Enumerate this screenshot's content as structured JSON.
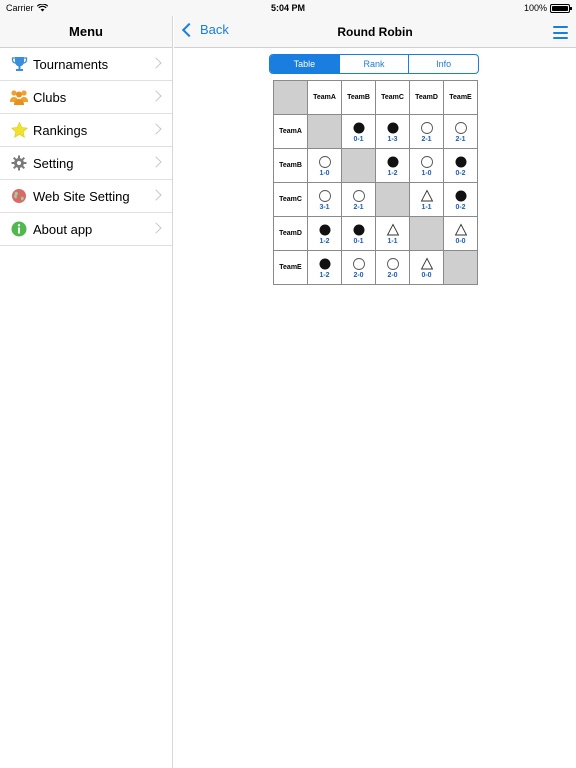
{
  "status": {
    "carrier": "Carrier",
    "time": "5:04 PM",
    "battery": "100%"
  },
  "sidebar": {
    "title": "Menu",
    "items": [
      {
        "label": "Tournaments",
        "icon": "trophy-icon"
      },
      {
        "label": "Clubs",
        "icon": "people-icon"
      },
      {
        "label": "Rankings",
        "icon": "star-icon"
      },
      {
        "label": "Setting",
        "icon": "gear-icon"
      },
      {
        "label": "Web Site Setting",
        "icon": "globe-icon"
      },
      {
        "label": "About app",
        "icon": "info-icon"
      }
    ]
  },
  "main": {
    "back_label": "Back",
    "title": "Round Robin",
    "tabs": [
      {
        "label": "Table",
        "active": true
      },
      {
        "label": "Rank",
        "active": false
      },
      {
        "label": "Info",
        "active": false
      }
    ],
    "teams": [
      "TeamA",
      "TeamB",
      "TeamC",
      "TeamD",
      "TeamE"
    ],
    "results": [
      [
        null,
        {
          "mark": "loss",
          "score": "0-1"
        },
        {
          "mark": "loss",
          "score": "1-3"
        },
        {
          "mark": "win",
          "score": "2-1"
        },
        {
          "mark": "win",
          "score": "2-1"
        }
      ],
      [
        {
          "mark": "win",
          "score": "1-0"
        },
        null,
        {
          "mark": "loss",
          "score": "1-2"
        },
        {
          "mark": "win",
          "score": "1-0"
        },
        {
          "mark": "loss",
          "score": "0-2"
        }
      ],
      [
        {
          "mark": "win",
          "score": "3-1"
        },
        {
          "mark": "win",
          "score": "2-1"
        },
        null,
        {
          "mark": "draw",
          "score": "1-1"
        },
        {
          "mark": "loss",
          "score": "0-2"
        }
      ],
      [
        {
          "mark": "loss",
          "score": "1-2"
        },
        {
          "mark": "loss",
          "score": "0-1"
        },
        {
          "mark": "draw",
          "score": "1-1"
        },
        null,
        {
          "mark": "draw",
          "score": "0-0"
        }
      ],
      [
        {
          "mark": "loss",
          "score": "1-2"
        },
        {
          "mark": "win",
          "score": "2-0"
        },
        {
          "mark": "win",
          "score": "2-0"
        },
        {
          "mark": "draw",
          "score": "0-0"
        },
        null
      ]
    ]
  },
  "colors": {
    "accent": "#1a7de0",
    "score": "#1a5fb4",
    "diagonal": "#cfcfcf"
  }
}
